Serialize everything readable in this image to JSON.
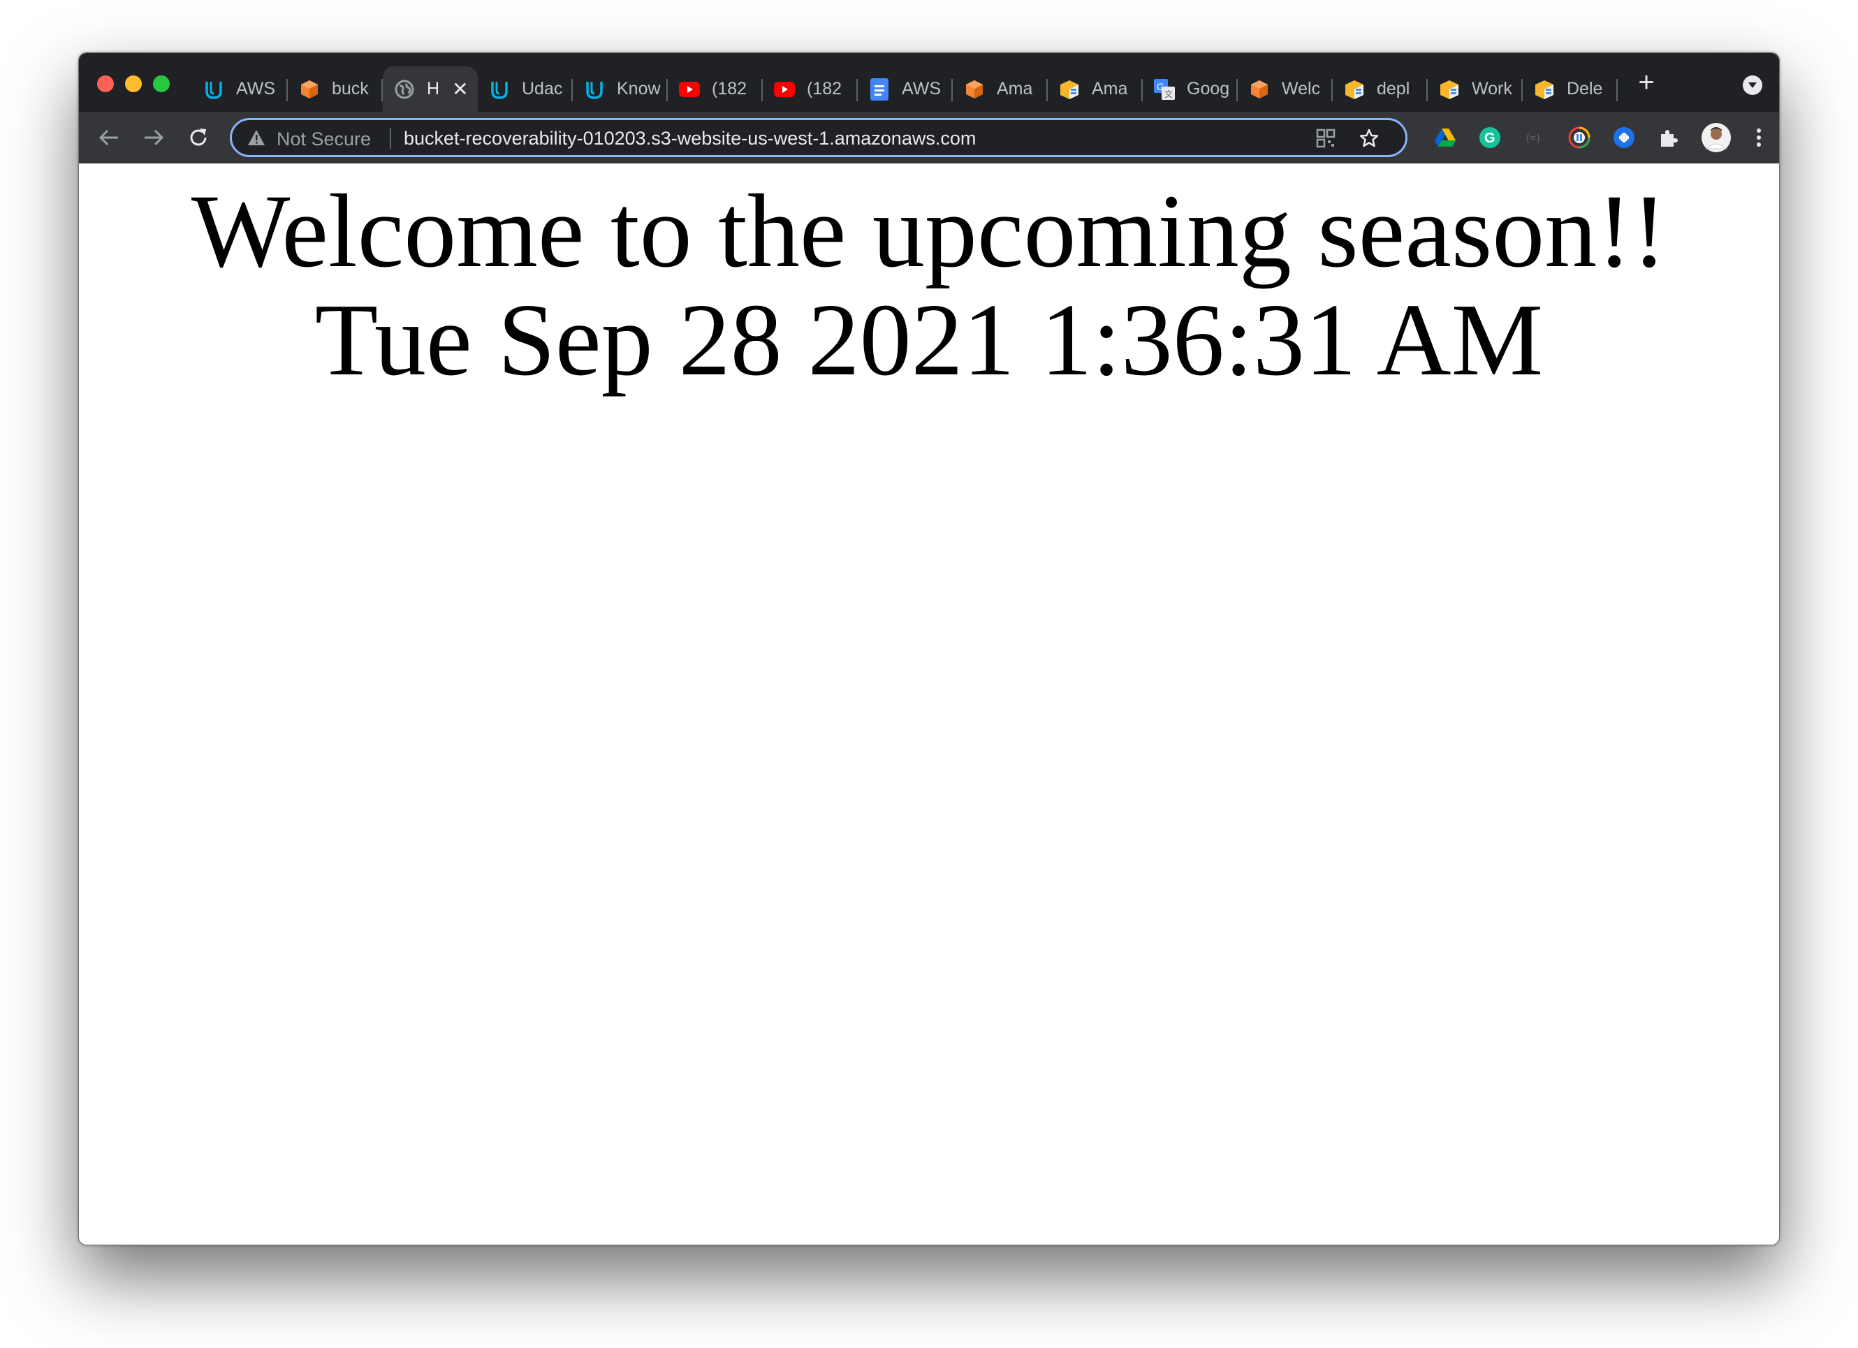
{
  "browser": {
    "tabs": [
      {
        "label": "AWS",
        "icon": "udacity-icon"
      },
      {
        "label": "buck",
        "icon": "aws-box-icon"
      },
      {
        "label": "H",
        "icon": "globe-icon",
        "active": true
      },
      {
        "label": "Udac",
        "icon": "udacity-icon"
      },
      {
        "label": "Know",
        "icon": "udacity-icon"
      },
      {
        "label": "(182",
        "icon": "youtube-icon"
      },
      {
        "label": "(182",
        "icon": "youtube-icon"
      },
      {
        "label": "AWS",
        "icon": "docs-icon"
      },
      {
        "label": "Ama",
        "icon": "aws-box-icon"
      },
      {
        "label": "Ama",
        "icon": "aws-service-icon"
      },
      {
        "label": "Goog",
        "icon": "google-translate-icon"
      },
      {
        "label": "Welc",
        "icon": "aws-box-icon"
      },
      {
        "label": "depl",
        "icon": "aws-service-icon"
      },
      {
        "label": "Work",
        "icon": "aws-service-icon"
      },
      {
        "label": "Dele",
        "icon": "aws-service-icon"
      }
    ],
    "omnibox": {
      "security_label": "Not Secure",
      "url": "bucket-recoverability-010203.s3-website-us-west-1.amazonaws.com"
    },
    "extensions": [
      "google-drive-icon",
      "grammarly-icon",
      "json-viewer-icon",
      "extension-circle-icon",
      "extension-blue-icon",
      "puzzle-icon",
      "profile-avatar"
    ],
    "colors": {
      "frame": "#202124",
      "toolbar": "#35363a",
      "omnibox_focus": "#8ab4f8"
    }
  },
  "page": {
    "headline": "Welcome to the upcoming season!!",
    "datetime": "Tue Sep 28 2021 1:36:31 AM"
  }
}
